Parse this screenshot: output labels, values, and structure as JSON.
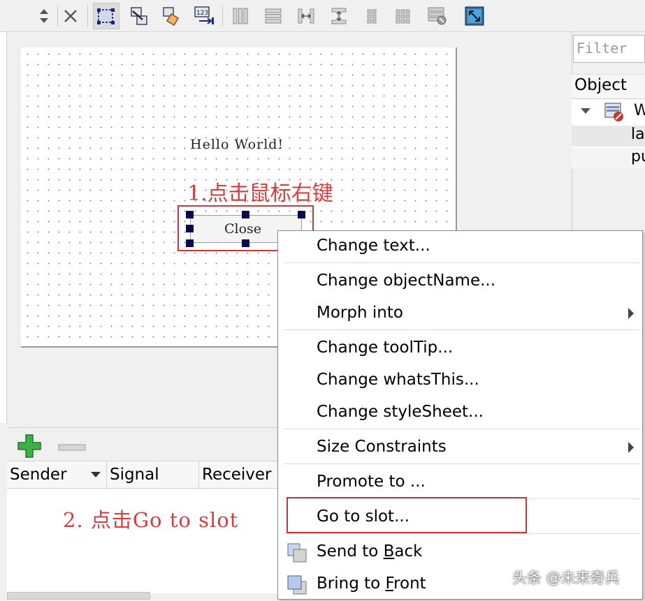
{
  "toolbar": {
    "buttons": [
      {
        "icon": "up-down-arrows-icon"
      },
      {
        "icon": "close-x-icon"
      },
      {
        "icon": "edit-widgets-icon",
        "active": true
      },
      {
        "icon": "edit-signals-slots-icon"
      },
      {
        "icon": "edit-buddies-icon"
      },
      {
        "icon": "edit-tab-order-icon"
      },
      {
        "icon": "layout-horizontal-icon"
      },
      {
        "icon": "layout-vertical-icon"
      },
      {
        "icon": "layout-h-splitter-icon"
      },
      {
        "icon": "layout-v-splitter-icon"
      },
      {
        "icon": "layout-form-icon"
      },
      {
        "icon": "layout-grid-icon"
      },
      {
        "icon": "break-layout-icon"
      },
      {
        "icon": "adjust-size-icon"
      }
    ]
  },
  "form": {
    "label_text": "Hello World!",
    "button_text": "Close"
  },
  "annotations": {
    "step1": "1.点击鼠标右键",
    "step2": "2. 点击Go to slot"
  },
  "object_inspector": {
    "filter_placeholder": "Filter",
    "header": "Object",
    "rows": [
      {
        "text": "W",
        "icon": "widget-icon",
        "expanded": true
      },
      {
        "text": "la"
      },
      {
        "text": "pu"
      }
    ]
  },
  "signal_slot_editor": {
    "columns": [
      "Sender",
      "Signal",
      "Receiver"
    ],
    "add_icon": "plus-icon",
    "remove_icon": "minus-icon"
  },
  "context_menu": {
    "items": [
      {
        "label": "Change text..."
      },
      {
        "label": "Change objectName..."
      },
      {
        "label": "Morph into",
        "submenu": true
      },
      {
        "label": "Change toolTip..."
      },
      {
        "label": "Change whatsThis..."
      },
      {
        "label": "Change styleSheet..."
      },
      {
        "label": "Size Constraints",
        "submenu": true
      },
      {
        "label": "Promote to ..."
      },
      {
        "label": "Go to slot...",
        "highlighted_box": true
      },
      {
        "label_pre": "Send to ",
        "label_acc": "B",
        "label_post": "ack",
        "icon": "send-to-back-icon"
      },
      {
        "label_pre": "Bring to ",
        "label_acc": "F",
        "label_post": "ront",
        "icon": "bring-to-front-icon"
      }
    ]
  },
  "watermark": "头条 @未来奇兵",
  "colors": {
    "annotation_red": "#d04040",
    "highlight_box": "#c0393b",
    "handle": "#0a0a4a"
  }
}
